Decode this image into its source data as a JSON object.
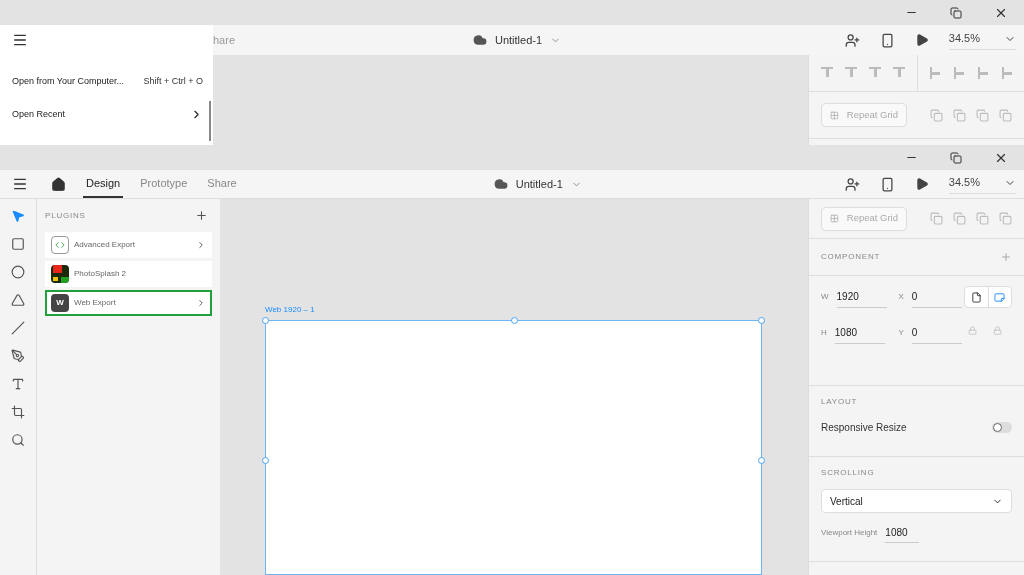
{
  "top_window": {
    "menu": {
      "items": [
        {
          "kind": "shortcut",
          "label": "Open from Your Computer...",
          "shortcut": "Shift + Ctrl + O"
        },
        {
          "kind": "submenu",
          "label": "Open Recent"
        }
      ]
    },
    "toolbar": {
      "tab_fragment": "hare",
      "document_title": "Untitled-1",
      "zoom": "34.5%"
    },
    "right_panel": {
      "repeat_grid": "Repeat Grid"
    }
  },
  "bottom_window": {
    "tabs": [
      {
        "label": "Design",
        "selected": true
      },
      {
        "label": "Prototype",
        "selected": false
      },
      {
        "label": "Share",
        "selected": false
      }
    ],
    "document_title": "Untitled-1",
    "zoom": "34.5%",
    "tools": [
      {
        "kind": "select",
        "selected": true
      },
      {
        "kind": "rectangle",
        "selected": false
      },
      {
        "kind": "ellipse",
        "selected": false
      },
      {
        "kind": "triangle",
        "selected": false
      },
      {
        "kind": "line",
        "selected": false
      },
      {
        "kind": "pen",
        "selected": false
      },
      {
        "kind": "text",
        "selected": false
      },
      {
        "kind": "artboard",
        "selected": false
      },
      {
        "kind": "zoom",
        "selected": false
      }
    ],
    "plugins": {
      "title": "PLUGINS",
      "items": [
        {
          "kind": "code",
          "name": "Advanced Export",
          "selected": false,
          "has_arrow": true
        },
        {
          "kind": "photo",
          "name": "PhotoSplash 2",
          "selected": false,
          "has_arrow": false
        },
        {
          "kind": "letter",
          "icon_text": "W",
          "name": "Web Export",
          "selected": true,
          "has_arrow": true
        }
      ]
    },
    "artboard": {
      "label": "Web 1920 – 1"
    },
    "right_panel": {
      "repeat_grid": "Repeat Grid",
      "component": {
        "title": "COMPONENT"
      },
      "orientation": [
        {
          "kind": "portrait",
          "selected": false
        },
        {
          "kind": "landscape",
          "selected": true
        }
      ],
      "fields": [
        {
          "label": "W",
          "value": "1920"
        },
        {
          "label": "X",
          "value": "0"
        },
        {
          "label": "H",
          "value": "1080"
        },
        {
          "label": "Y",
          "value": "0"
        }
      ],
      "layout": {
        "title": "LAYOUT",
        "label": "Responsive Resize",
        "on": false
      },
      "scrolling": {
        "title": "SCROLLING",
        "value": "Vertical",
        "viewport_label": "Viewport Height",
        "viewport_value": "1080"
      }
    }
  }
}
